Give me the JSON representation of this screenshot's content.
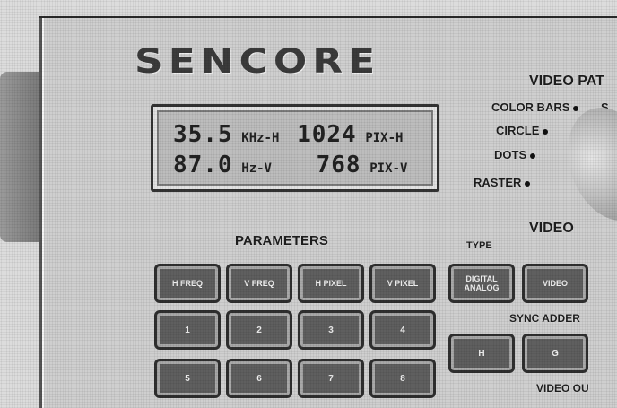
{
  "brand": "SENCORE",
  "display": {
    "h_freq_value": "35.5",
    "h_freq_unit": "KHz-H",
    "h_pixel_value": "1024",
    "h_pixel_unit": "PIX-H",
    "v_freq_value": "87.0",
    "v_freq_unit": "Hz-V",
    "v_pixel_value": "768",
    "v_pixel_unit": "PIX-V"
  },
  "video_patterns": {
    "title": "VIDEO PAT",
    "options": [
      "COLOR BARS",
      "CIRCLE",
      "DOTS",
      "RASTER"
    ],
    "extra_s": "S"
  },
  "parameters": {
    "title": "PARAMETERS",
    "keys_row1": [
      "H FREQ",
      "V FREQ",
      "H PIXEL",
      "V PIXEL"
    ],
    "keys_row2": [
      "1",
      "2",
      "3",
      "4"
    ],
    "keys_row3": [
      "5",
      "6",
      "7",
      "8"
    ]
  },
  "type_section": {
    "title": "TYPE",
    "digital": "DIGITAL",
    "analog": "ANALOG"
  },
  "video_section": {
    "title": "VIDEO",
    "key_label": "VIDEO"
  },
  "sync_adder": {
    "title": "SYNC ADDER",
    "keys": [
      "H",
      "G"
    ]
  },
  "video_out": "VIDEO OU"
}
